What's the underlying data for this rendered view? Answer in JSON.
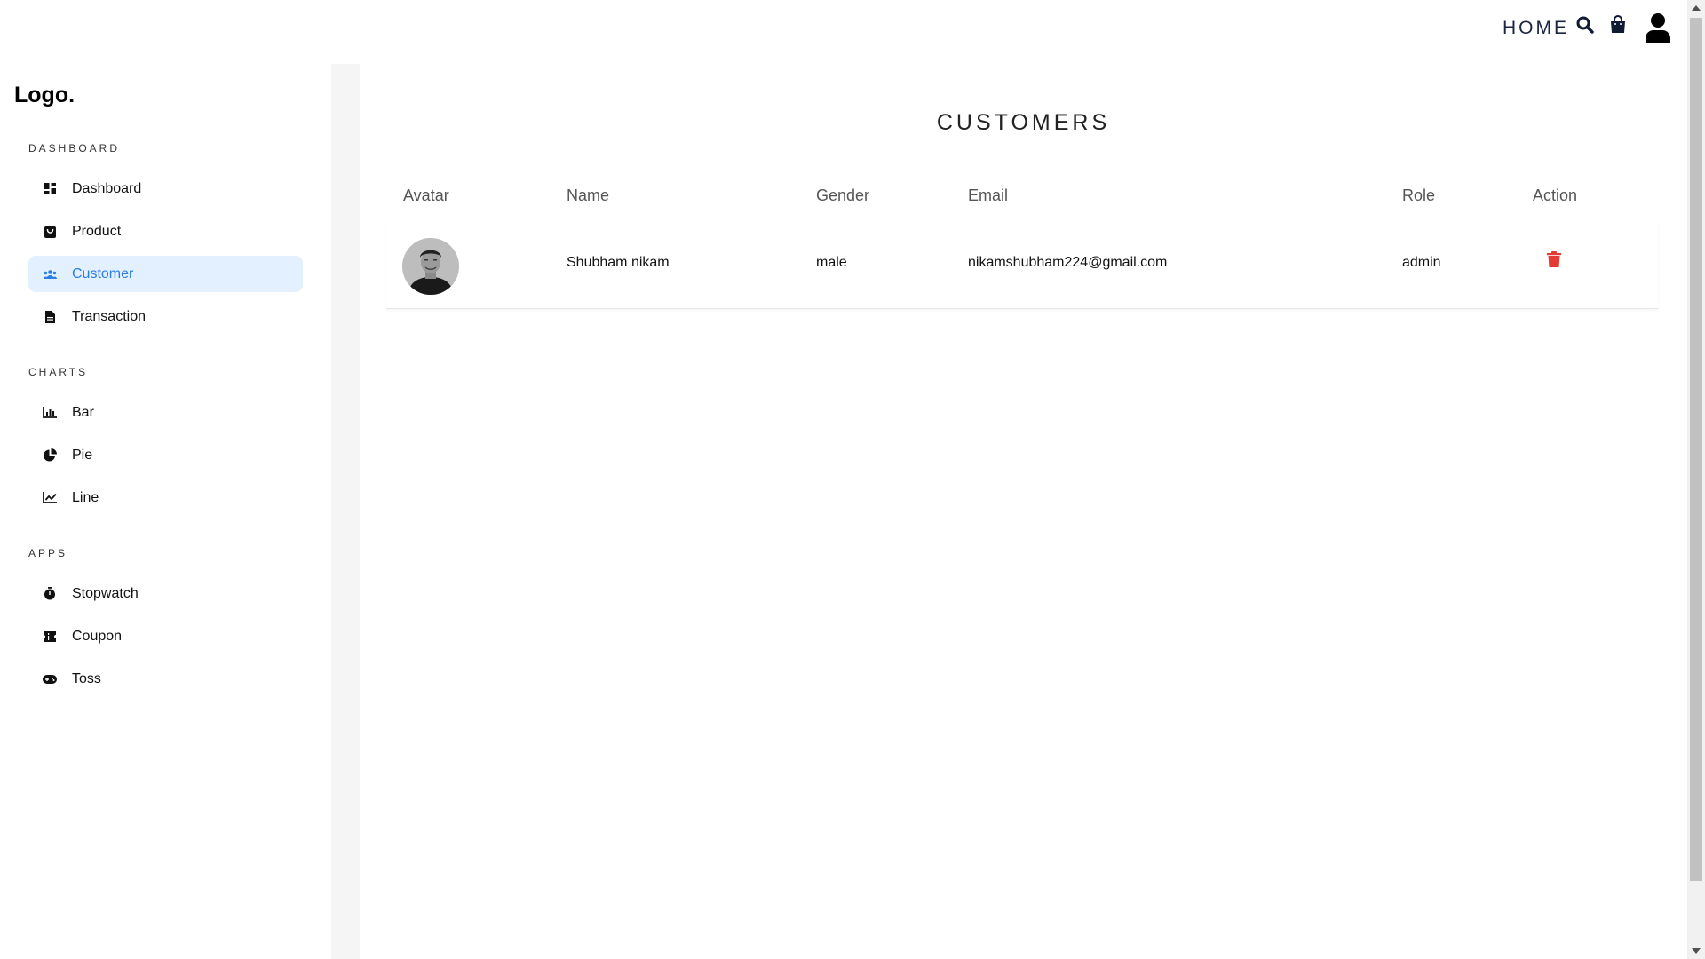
{
  "topnav": {
    "home_label": "HOME",
    "icons": [
      "search-icon",
      "shopping-bag-icon",
      "user-icon"
    ]
  },
  "sidebar": {
    "logo": "Logo.",
    "sections": [
      {
        "title": "DASHBOARD",
        "items": [
          {
            "label": "Dashboard",
            "icon": "dashboard-icon",
            "active": false
          },
          {
            "label": "Product",
            "icon": "product-icon",
            "active": false
          },
          {
            "label": "Customer",
            "icon": "customers-icon",
            "active": true
          },
          {
            "label": "Transaction",
            "icon": "document-icon",
            "active": false
          }
        ]
      },
      {
        "title": "CHARTS",
        "items": [
          {
            "label": "Bar",
            "icon": "bar-chart-icon",
            "active": false
          },
          {
            "label": "Pie",
            "icon": "pie-chart-icon",
            "active": false
          },
          {
            "label": "Line",
            "icon": "line-chart-icon",
            "active": false
          }
        ]
      },
      {
        "title": "APPS",
        "items": [
          {
            "label": "Stopwatch",
            "icon": "stopwatch-icon",
            "active": false
          },
          {
            "label": "Coupon",
            "icon": "coupon-icon",
            "active": false
          },
          {
            "label": "Toss",
            "icon": "gamepad-icon",
            "active": false
          }
        ]
      }
    ]
  },
  "main": {
    "title": "CUSTOMERS",
    "table": {
      "headers": [
        "Avatar",
        "Name",
        "Gender",
        "Email",
        "Role",
        "Action"
      ],
      "rows": [
        {
          "avatar": "avatar-photo",
          "name": "Shubham nikam",
          "gender": "male",
          "email": "nikamshubham224@gmail.com",
          "role": "admin",
          "action": "trash-icon"
        }
      ]
    }
  },
  "colors": {
    "accent": "#2a7de1",
    "active_bg": "#e3f0ff",
    "delete": "#e53935",
    "nav_text": "#1b2540"
  }
}
